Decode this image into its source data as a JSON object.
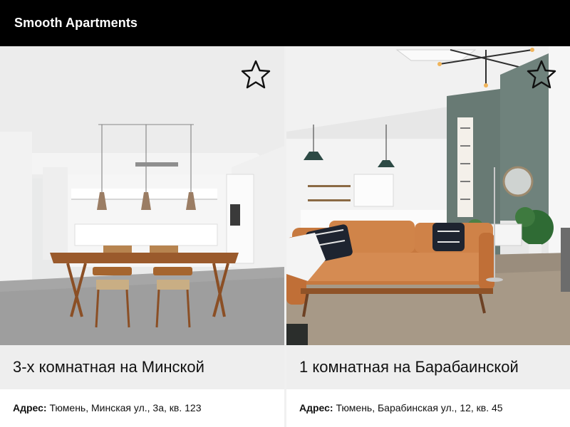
{
  "header": {
    "brand": "Smooth Apartments"
  },
  "listings": [
    {
      "title": "3-х комнатная на Минской",
      "address_label": "Адрес:",
      "address": "Тюмень, Минская ул., 3а, кв. 123",
      "favorite_icon": "star-outline-icon"
    },
    {
      "title": "1 комнатная на Барабаинской",
      "address_label": "Адрес:",
      "address": "Тюмень, Барабинская ул., 12, кв. 45",
      "favorite_icon": "star-outline-icon"
    }
  ]
}
